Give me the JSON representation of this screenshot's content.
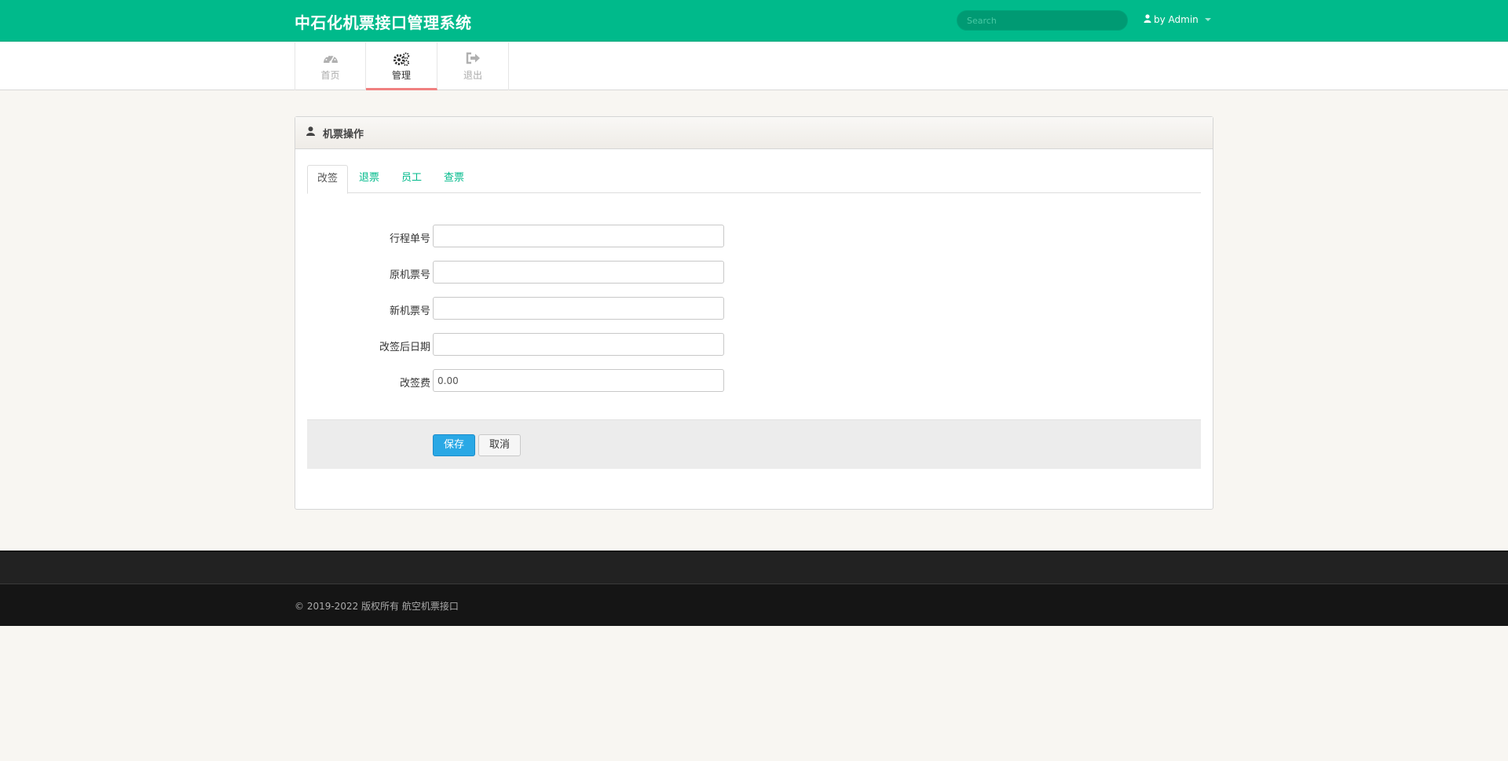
{
  "header": {
    "title": "中石化机票接口管理系统",
    "search_placeholder": "Search",
    "user_label": "by Admin",
    "user_icon": "user-icon"
  },
  "nav": {
    "items": [
      {
        "label": "首页",
        "icon": "dashboard-icon",
        "active": false
      },
      {
        "label": "管理",
        "icon": "cogs-icon",
        "active": true
      },
      {
        "label": "退出",
        "icon": "sign-out-icon",
        "active": false
      }
    ]
  },
  "panel": {
    "title": "机票操作",
    "icon": "user-icon",
    "tabs": [
      {
        "label": "改签",
        "active": true
      },
      {
        "label": "退票",
        "active": false
      },
      {
        "label": "员工",
        "active": false
      },
      {
        "label": "查票",
        "active": false
      }
    ],
    "fields": [
      {
        "label": "行程单号",
        "value": ""
      },
      {
        "label": "原机票号",
        "value": ""
      },
      {
        "label": "新机票号",
        "value": ""
      },
      {
        "label": "改签后日期",
        "value": ""
      },
      {
        "label": "改签费",
        "value": "0.00"
      }
    ],
    "save_label": "保存",
    "cancel_label": "取消"
  },
  "footer": {
    "copyright": "© 2019-2022 版权所有 航空机票接口"
  },
  "colors": {
    "accent": "#00ba8b",
    "primary_button": "#2aa8e5",
    "active_tab_underline": "#f08080"
  }
}
